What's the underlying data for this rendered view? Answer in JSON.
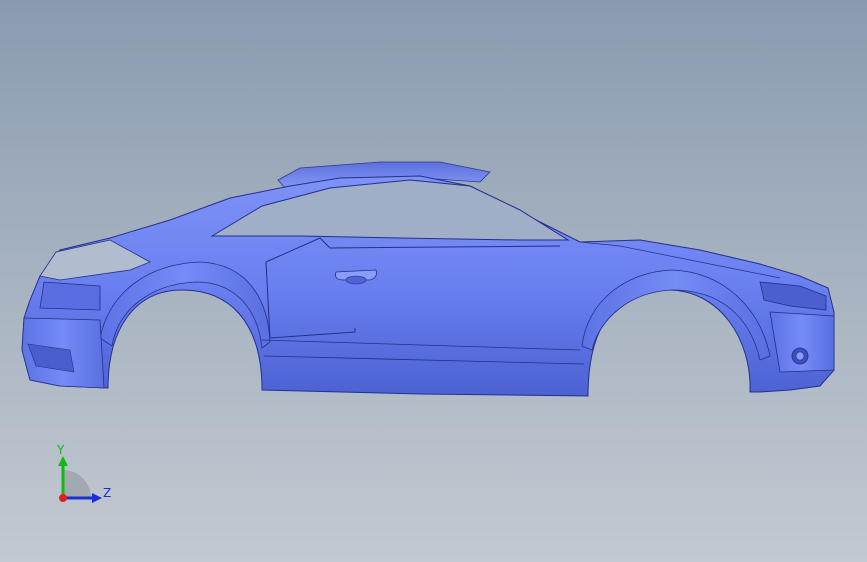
{
  "viewport": {
    "background_top": "#8a9bb0",
    "background_bottom": "#c3c9d1",
    "model_color": "#6a80f0"
  },
  "model": {
    "name": "car-body-surface-model"
  },
  "triad": {
    "y_label": "Y",
    "z_label": "Z",
    "y_color": "#14b814",
    "z_color": "#1a2fd6",
    "x_color": "#e02020"
  }
}
